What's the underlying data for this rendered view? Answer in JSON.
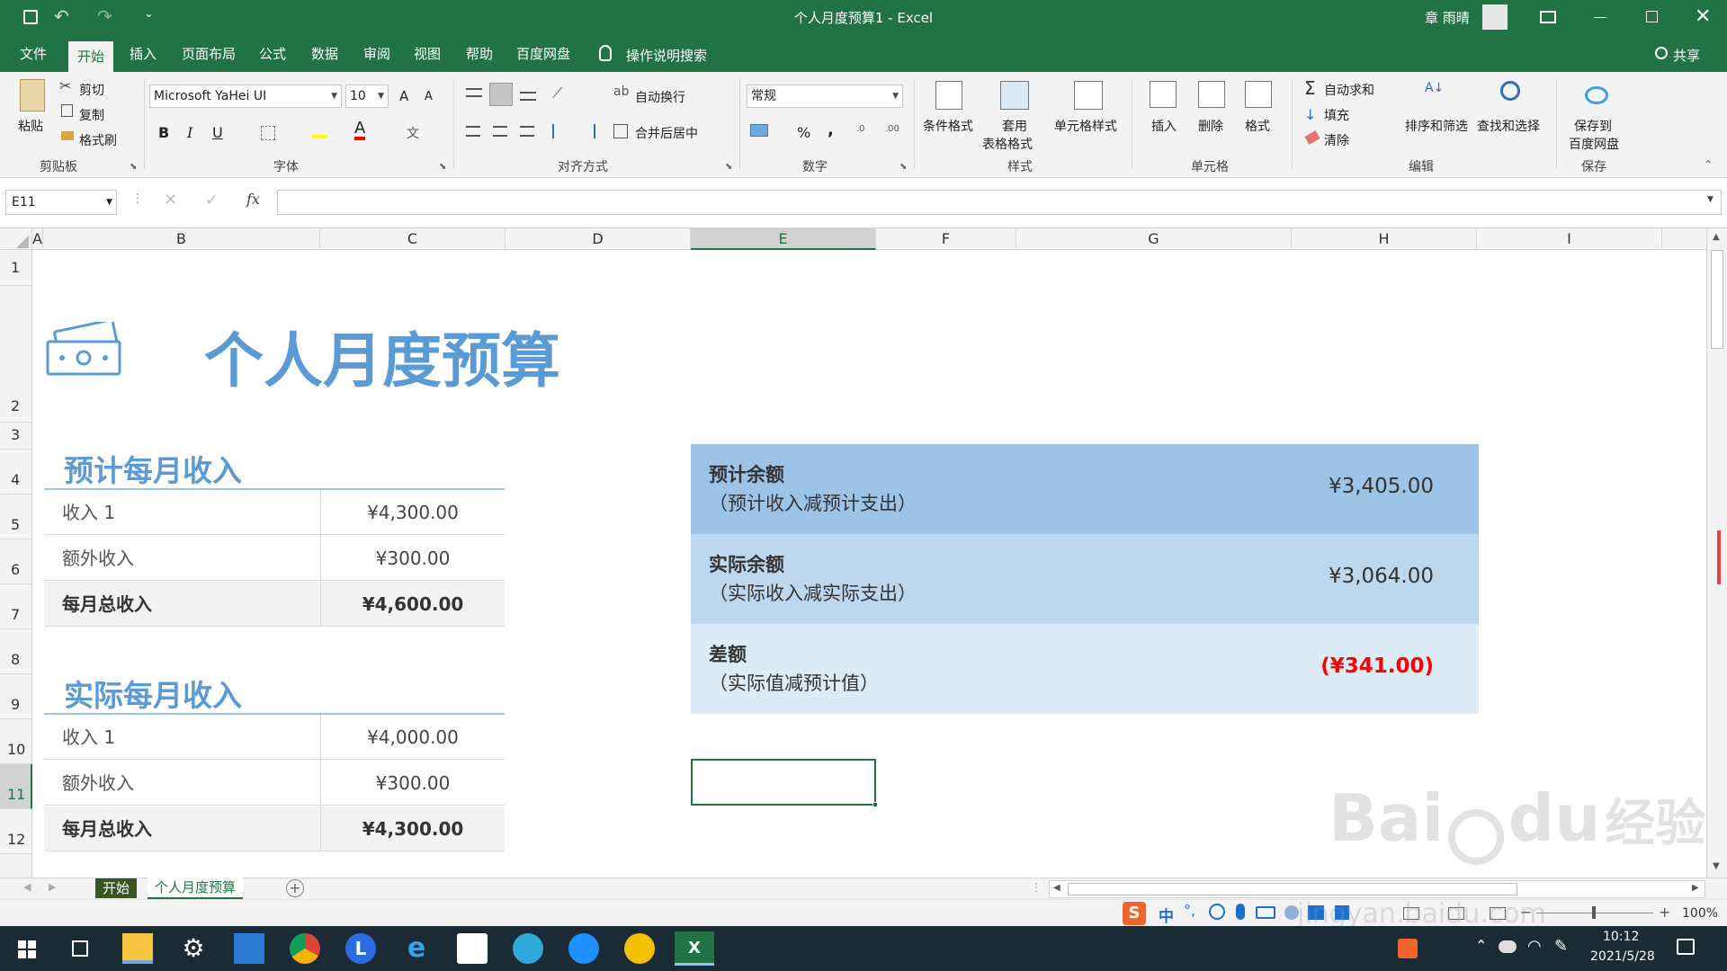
{
  "window": {
    "title": "个人月度预算1  -  Excel",
    "user": "章 雨晴"
  },
  "qat": {
    "more": "⌄"
  },
  "tabs": [
    "文件",
    "开始",
    "插入",
    "页面布局",
    "公式",
    "数据",
    "审阅",
    "视图",
    "帮助",
    "百度网盘"
  ],
  "tell_me": "操作说明搜索",
  "share": "共享",
  "ribbon": {
    "clipboard": {
      "paste": "粘贴",
      "cut": "剪切",
      "copy": "复制",
      "painter": "格式刷",
      "label": "剪贴板"
    },
    "font": {
      "name": "Microsoft YaHei UI",
      "size": "10",
      "bold": "B",
      "italic": "I",
      "underline": "U",
      "label": "字体",
      "grow": "A",
      "shrink": "A"
    },
    "align": {
      "wrap": "自动换行",
      "merge": "合并后居中",
      "label": "对齐方式"
    },
    "number": {
      "format": "常规",
      "percent": "%",
      "comma": ",",
      "label": "数字"
    },
    "styles": {
      "cond": "条件格式",
      "table1": "套用",
      "table2": "表格格式",
      "cell": "单元格样式",
      "label": "样式"
    },
    "cells": {
      "insert": "插入",
      "delete": "删除",
      "format": "格式",
      "label": "单元格"
    },
    "edit": {
      "autosum": "自动求和",
      "fill": "填充",
      "clear": "清除",
      "sort": "排序和筛选",
      "find": "查找和选择",
      "label": "编辑"
    },
    "save": {
      "line1": "保存到",
      "line2": "百度网盘",
      "label": "保存"
    }
  },
  "namebox": "E11",
  "fx": "fx",
  "columns": [
    "A",
    "B",
    "C",
    "D",
    "E",
    "F",
    "G",
    "H",
    "I"
  ],
  "rows": [
    "1",
    "2",
    "3",
    "4",
    "5",
    "6",
    "7",
    "8",
    "9",
    "10",
    "11",
    "12"
  ],
  "sheet": {
    "title": "个人月度预算",
    "planned_title": "预计每月收入",
    "planned": [
      {
        "label": "收入 1",
        "value": "¥4,300.00"
      },
      {
        "label": "额外收入",
        "value": "¥300.00"
      },
      {
        "label": "每月总收入",
        "value": "¥4,600.00"
      }
    ],
    "actual_title": "实际每月收入",
    "actual": [
      {
        "label": "收入 1",
        "value": "¥4,000.00"
      },
      {
        "label": "额外收入",
        "value": "¥300.00"
      },
      {
        "label": "每月总收入",
        "value": "¥4,300.00"
      }
    ],
    "balances": [
      {
        "t1": "预计余额",
        "t2": "（预计收入减预计支出）",
        "value": "¥3,405.00",
        "bg": "#9dc3e6",
        "color": "#333333"
      },
      {
        "t1": "实际余额",
        "t2": "（实际收入减实际支出）",
        "value": "¥3,064.00",
        "bg": "#bdd7ee",
        "color": "#333333"
      },
      {
        "t1": "差额",
        "t2": "（实际值减预计值）",
        "value": "(¥341.00)",
        "bg": "#ddebf7",
        "color": "#ff0000"
      }
    ]
  },
  "sheettabs": [
    "开始",
    "个人月度预算"
  ],
  "status": {
    "zoom": "100%"
  },
  "clock": {
    "time": "10:12",
    "date": "2021/5/28"
  },
  "ime": {
    "mode": "中"
  },
  "watermark": {
    "brand": "Bai",
    "brand2": "du",
    "cn": "经验",
    "url": "jingyan.baidu.com"
  }
}
